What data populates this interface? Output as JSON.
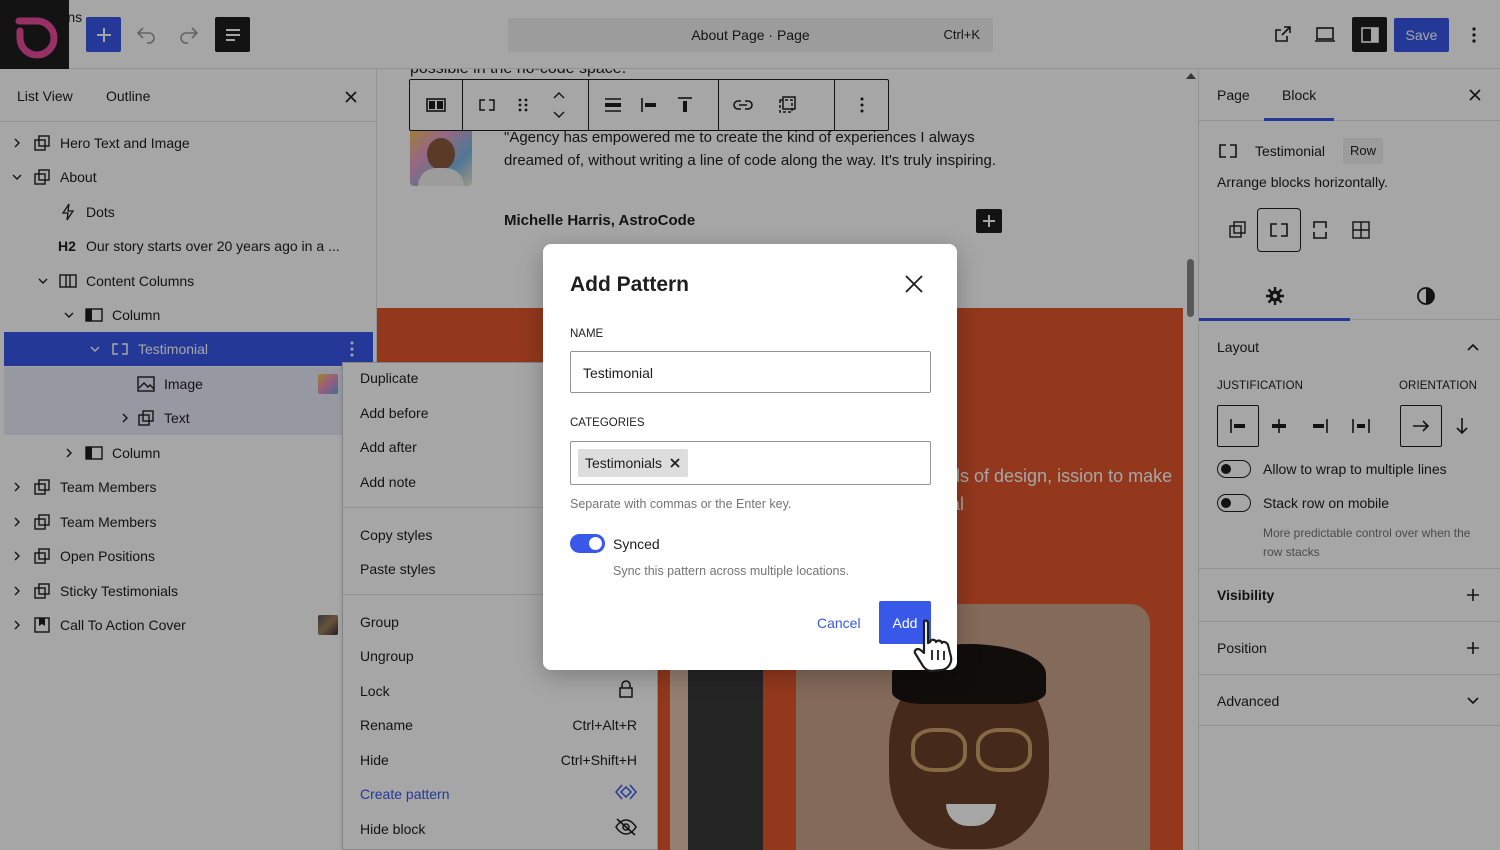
{
  "header": {
    "patterns_label": "Patterns",
    "doc_title": "About Page · Page",
    "doc_shortcut": "Ctrl+K",
    "save_label": "Save"
  },
  "list_view": {
    "tabs": [
      "List View",
      "Outline"
    ],
    "items": [
      {
        "label": "Hero Text and Image"
      },
      {
        "label": "About"
      },
      {
        "label": "Dots"
      },
      {
        "tag": "H2",
        "label": "Our story starts over 20 years ago in a ..."
      },
      {
        "label": "Content Columns"
      },
      {
        "label": "Column"
      },
      {
        "label": "Testimonial"
      },
      {
        "label": "Image"
      },
      {
        "label": "Text"
      },
      {
        "label": "Column"
      },
      {
        "label": "Team Members"
      },
      {
        "label": "Team Members"
      },
      {
        "label": "Open Positions"
      },
      {
        "label": "Sticky Testimonials"
      },
      {
        "label": "Call To Action Cover"
      }
    ]
  },
  "canvas": {
    "intro_fragment": "possible in the no-code space.",
    "quote": "\"Agency has empowered me to create the kind of experiences I always dreamed of, without writing a line of code along the way. It's truly inspiring.",
    "author": "Michelle Harris, AstroCode",
    "orange_text": "worlds of design, ission to make digital"
  },
  "context_menu": {
    "items": [
      {
        "label": "Duplicate"
      },
      {
        "label": "Add before"
      },
      {
        "label": "Add after"
      },
      {
        "label": "Add note"
      },
      {
        "label": "Copy styles"
      },
      {
        "label": "Paste styles"
      },
      {
        "label": "Group"
      },
      {
        "label": "Ungroup"
      },
      {
        "label": "Lock"
      },
      {
        "label": "Rename",
        "shortcut": "Ctrl+Alt+R"
      },
      {
        "label": "Hide",
        "shortcut": "Ctrl+Shift+H"
      },
      {
        "label": "Create pattern"
      },
      {
        "label": "Hide block"
      }
    ]
  },
  "modal": {
    "title": "Add Pattern",
    "name_label": "NAME",
    "name_value": "Testimonial",
    "categories_label": "CATEGORIES",
    "category_token": "Testimonials",
    "categories_help": "Separate with commas or the Enter key.",
    "synced_label": "Synced",
    "synced_on": true,
    "synced_help": "Sync this pattern across multiple locations.",
    "cancel_label": "Cancel",
    "add_label": "Add"
  },
  "inspector": {
    "tabs": [
      "Page",
      "Block"
    ],
    "block_name": "Testimonial",
    "block_badge": "Row",
    "block_desc": "Arrange blocks horizontally.",
    "layout_title": "Layout",
    "justification_label": "JUSTIFICATION",
    "orientation_label": "ORIENTATION",
    "wrap_label": "Allow to wrap to multiple lines",
    "stack_label": "Stack row on mobile",
    "stack_help": "More predictable control over when the row stacks",
    "sections": [
      "Visibility",
      "Position",
      "Advanced"
    ]
  },
  "colors": {
    "accent": "#3858e9",
    "brand_orange": "#e2572b",
    "dark": "#1e1e1e"
  }
}
